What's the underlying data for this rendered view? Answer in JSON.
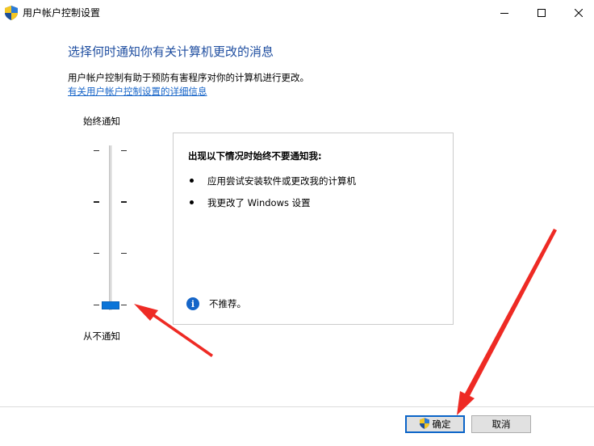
{
  "window": {
    "title": "用户帐户控制设置"
  },
  "header": {
    "heading": "选择何时通知你有关计算机更改的消息",
    "description": "用户帐户控制有助于预防有害程序对你的计算机进行更改。",
    "link": "有关用户帐户控制设置的详细信息"
  },
  "slider": {
    "top_label": "始终通知",
    "bottom_label": "从不通知",
    "levels": 4,
    "current_level": 1
  },
  "panel": {
    "title": "出现以下情况时始终不要通知我:",
    "items": [
      "应用尝试安装软件或更改我的计算机",
      "我更改了 Windows 设置"
    ],
    "info_text": "不推荐。"
  },
  "footer": {
    "ok_label": "确定",
    "cancel_label": "取消"
  },
  "icons": {
    "title": "uac-shield-icon",
    "minimize": "minimize-icon",
    "maximize": "maximize-icon",
    "close": "close-icon",
    "info": "info-icon",
    "ok": "uac-shield-icon"
  },
  "colors": {
    "heading": "#1f4ea0",
    "link": "#1664c8",
    "thumb": "#0a74d8",
    "annotation": "#ee2a24"
  }
}
